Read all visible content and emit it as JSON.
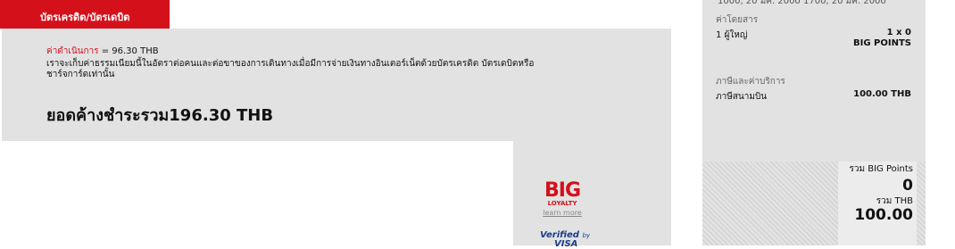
{
  "tab": {
    "label": "บัตรเครดิต/บัตรเดบิต"
  },
  "payment": {
    "fee_label": "ค่าดำเนินการ",
    "fee_value": " = 96.30 THB",
    "fee_description": "เราจะเก็บค่าธรรมเนียมนี้ในอัตราต่อคนและต่อขาของการเดินทางเมื่อมีการจ่ายเงินทางอินเตอร์เน็ตด้วยบัตรเครดิต บัตรเดบิตหรือชาร์จการ์ดเท่านั้น",
    "total_due": "ยอดค้างชำระรวม196.30 THB"
  },
  "logos": {
    "big": "BIG",
    "loyalty": "LOYALTY",
    "learn_more": "learn more",
    "verified": "Verified",
    "by": "by",
    "visa": "VISA"
  },
  "sidebar": {
    "top_cut": "1000, 20 มค. 2000      1700, 20 มค. 2000",
    "fare_section": "ค่าโดยสาร",
    "fare_row_label": "1 ผู้ใหญ่",
    "fare_row_value_1": "1 x 0",
    "fare_row_value_2": "BIG POINTS",
    "tax_section": "ภาษีและค่าบริการ",
    "tax_row_label": "ภาษีสนามบิน",
    "tax_row_value": "100.00 THB",
    "totals": {
      "points_label": "รวม BIG Points",
      "points_value": "0",
      "thb_label": "รวม THB",
      "thb_value": "100.00"
    }
  },
  "colors": {
    "accent": "#d4111b",
    "panel": "#e2e2e2",
    "visa_blue": "#1a3e8c"
  }
}
